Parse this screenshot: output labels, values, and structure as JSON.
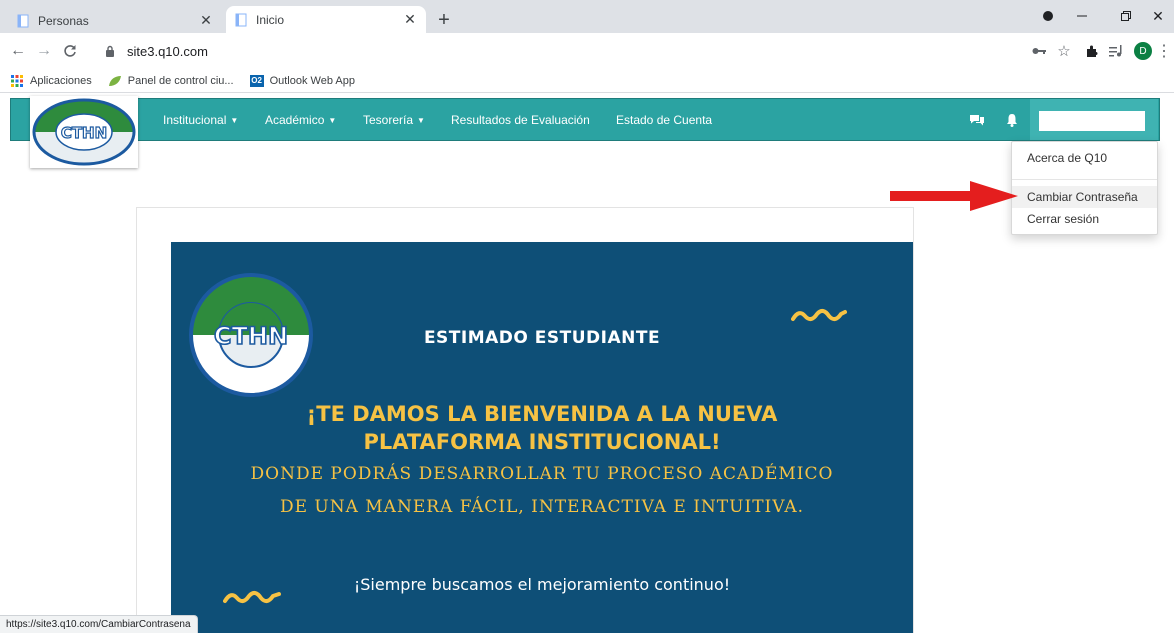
{
  "browser": {
    "tabs": [
      {
        "title": "Personas"
      },
      {
        "title": "Inicio"
      }
    ],
    "url": "site3.q10.com",
    "profile_initial": "D",
    "bookmarks": [
      {
        "label": "Aplicaciones"
      },
      {
        "label": "Panel de control ciu..."
      },
      {
        "label": "Outlook Web App",
        "icon_text": "O2"
      }
    ],
    "status_url": "https://site3.q10.com/CambiarContrasena"
  },
  "navbar": {
    "items": [
      {
        "label": "Institucional"
      },
      {
        "label": "Académico"
      },
      {
        "label": "Tesorería"
      },
      {
        "label": "Resultados de Evaluación"
      },
      {
        "label": "Estado de Cuenta"
      }
    ],
    "logo_text": "CTHN",
    "brand_color": "#2ba3a2"
  },
  "user_menu": {
    "items": [
      {
        "label": "Acerca de Q10"
      },
      {
        "label": "Cambiar Contraseña"
      },
      {
        "label": "Cerrar sesión"
      }
    ]
  },
  "banner": {
    "heading": "ESTIMADO ESTUDIANTE",
    "welcome_line1": "¡TE DAMOS LA BIENVENIDA A LA NUEVA",
    "welcome_line2": "PLATAFORMA INSTITUCIONAL!",
    "sub_line1": "DONDE PODRÁS DESARROLLAR TU PROCESO ACADÉMICO",
    "sub_line2": "DE UNA MANERA FÁCIL, INTERACTIVA E INTUITIVA.",
    "footer": "¡Siempre buscamos el mejoramiento continuo!",
    "logo_text": "CTHN",
    "background_color": "#0e4f77",
    "accent_color": "#f6c244"
  }
}
